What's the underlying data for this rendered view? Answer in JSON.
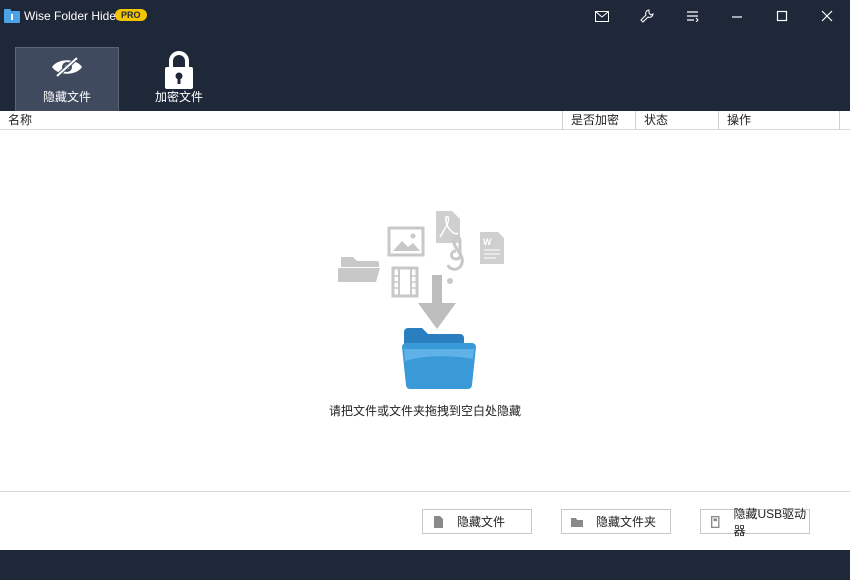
{
  "window": {
    "title": "Wise Folder Hider",
    "badge": "PRO"
  },
  "tabs": [
    {
      "label": "隐藏文件",
      "icon": "eye-slash-icon",
      "active": true
    },
    {
      "label": "加密文件",
      "icon": "lock-icon",
      "active": false
    }
  ],
  "table": {
    "columns": [
      "名称",
      "是否加密",
      "状态",
      "操作"
    ]
  },
  "drop_area": {
    "hint": "请把文件或文件夹拖拽到空白处隐藏"
  },
  "footer": {
    "buttons": [
      {
        "label": "隐藏文件",
        "icon": "file-icon"
      },
      {
        "label": "隐藏文件夹",
        "icon": "folder-icon"
      },
      {
        "label": "隐藏USB驱动器",
        "icon": "usb-icon"
      }
    ]
  },
  "colors": {
    "titlebar_bg": "#1f2838",
    "active_tab_bg": "#3f4a5e",
    "badge": "#f3c400",
    "folder_blue": "#3a9ad8"
  }
}
